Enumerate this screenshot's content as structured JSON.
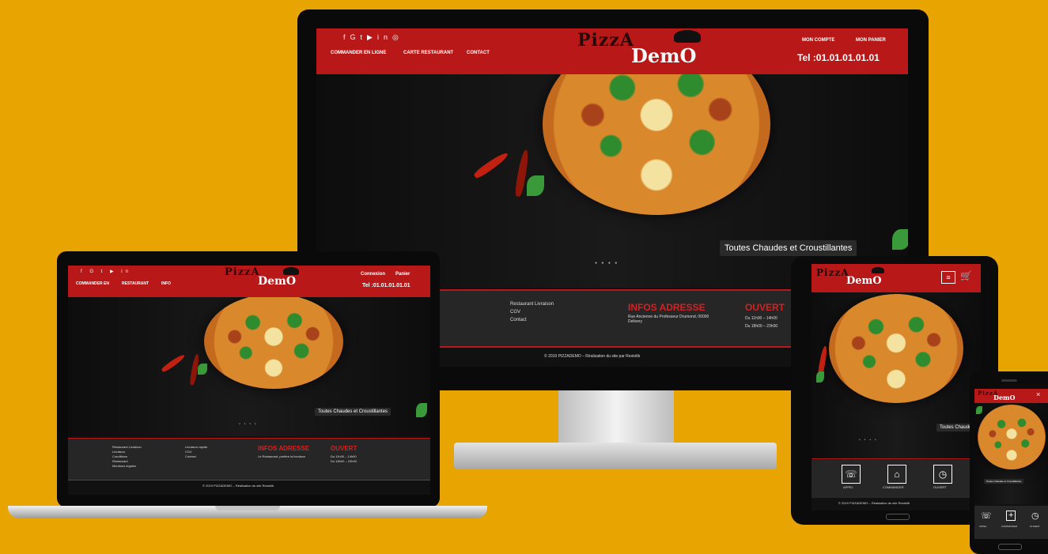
{
  "colors": {
    "background": "#e8a400",
    "brand_red": "#b81818",
    "dark": "#111111"
  },
  "brand": {
    "logo_top": "PizzA",
    "logo_bottom": "DemO"
  },
  "desktop": {
    "nav": [
      "COMMANDER EN LIGNE",
      "CARTE RESTAURANT",
      "CONTACT"
    ],
    "account": [
      "MON COMPTE",
      "MON PANIER"
    ],
    "phone": "Tel :01.01.01.01.01",
    "social_icons": [
      "facebook-icon",
      "google-plus-icon",
      "twitter-icon",
      "youtube-icon",
      "linkedin-icon",
      "instagram-icon"
    ],
    "caption": "Toutes Chaudes et Croustillantes",
    "slider_dots": "● ● ● ●",
    "footer_links": [
      "Restaurant Livraison",
      "CGV",
      "Contact"
    ],
    "footer_address_title": "INFOS ADRESSE",
    "footer_address_text": "Rue Ancienne du Professeur Drumond, 00000 Delivery",
    "footer_hours_title": "OUVERT",
    "footer_hours": [
      "Du 11h00 – 14h00",
      "Du 18h00 – 23h00"
    ],
    "copyright": "© 2019 PIZZADEMO – Réalisation du site par Restolib"
  },
  "laptop": {
    "nav": [
      "COMMANDER EN",
      "RESTAURANT",
      "INFO"
    ],
    "account": [
      "Connexion",
      "Panier"
    ],
    "phone": "Tel :01.01.01.01.01",
    "caption": "Toutes Chaudes et Croustillantes",
    "footer_col1": [
      "Restaurant Livraison",
      "Livraison",
      "Conditions",
      "Restaurant",
      "Mentions légales"
    ],
    "footer_col2": [
      "Livraison rapide",
      "CGV",
      "Contact"
    ],
    "footer_address_title": "INFOS ADRESSE",
    "footer_address_text": "Le Restaurant, prefère la livraison",
    "footer_hours_title": "OUVERT",
    "footer_hours": [
      "Du 11h00 – 14h00",
      "Du 18h00 – 23h00"
    ],
    "copyright": "© 2019 PIZZADEMO – Réalisation du site Restolib"
  },
  "tablet": {
    "caption": "Toutes Chaudes",
    "buttons": [
      {
        "label": "APPEL",
        "icon": "phone-icon"
      },
      {
        "label": "COMMANDER",
        "icon": "order-icon"
      },
      {
        "label": "OUVERT",
        "icon": "clock-icon"
      }
    ],
    "copyright": "© 2019 PIZZADEMO – Réalisation du site Restolib"
  },
  "phone": {
    "caption": "Toutes Chaudes et Croustillantes",
    "buttons": [
      "APPEL",
      "COMMANDER",
      "OUVERT"
    ]
  }
}
